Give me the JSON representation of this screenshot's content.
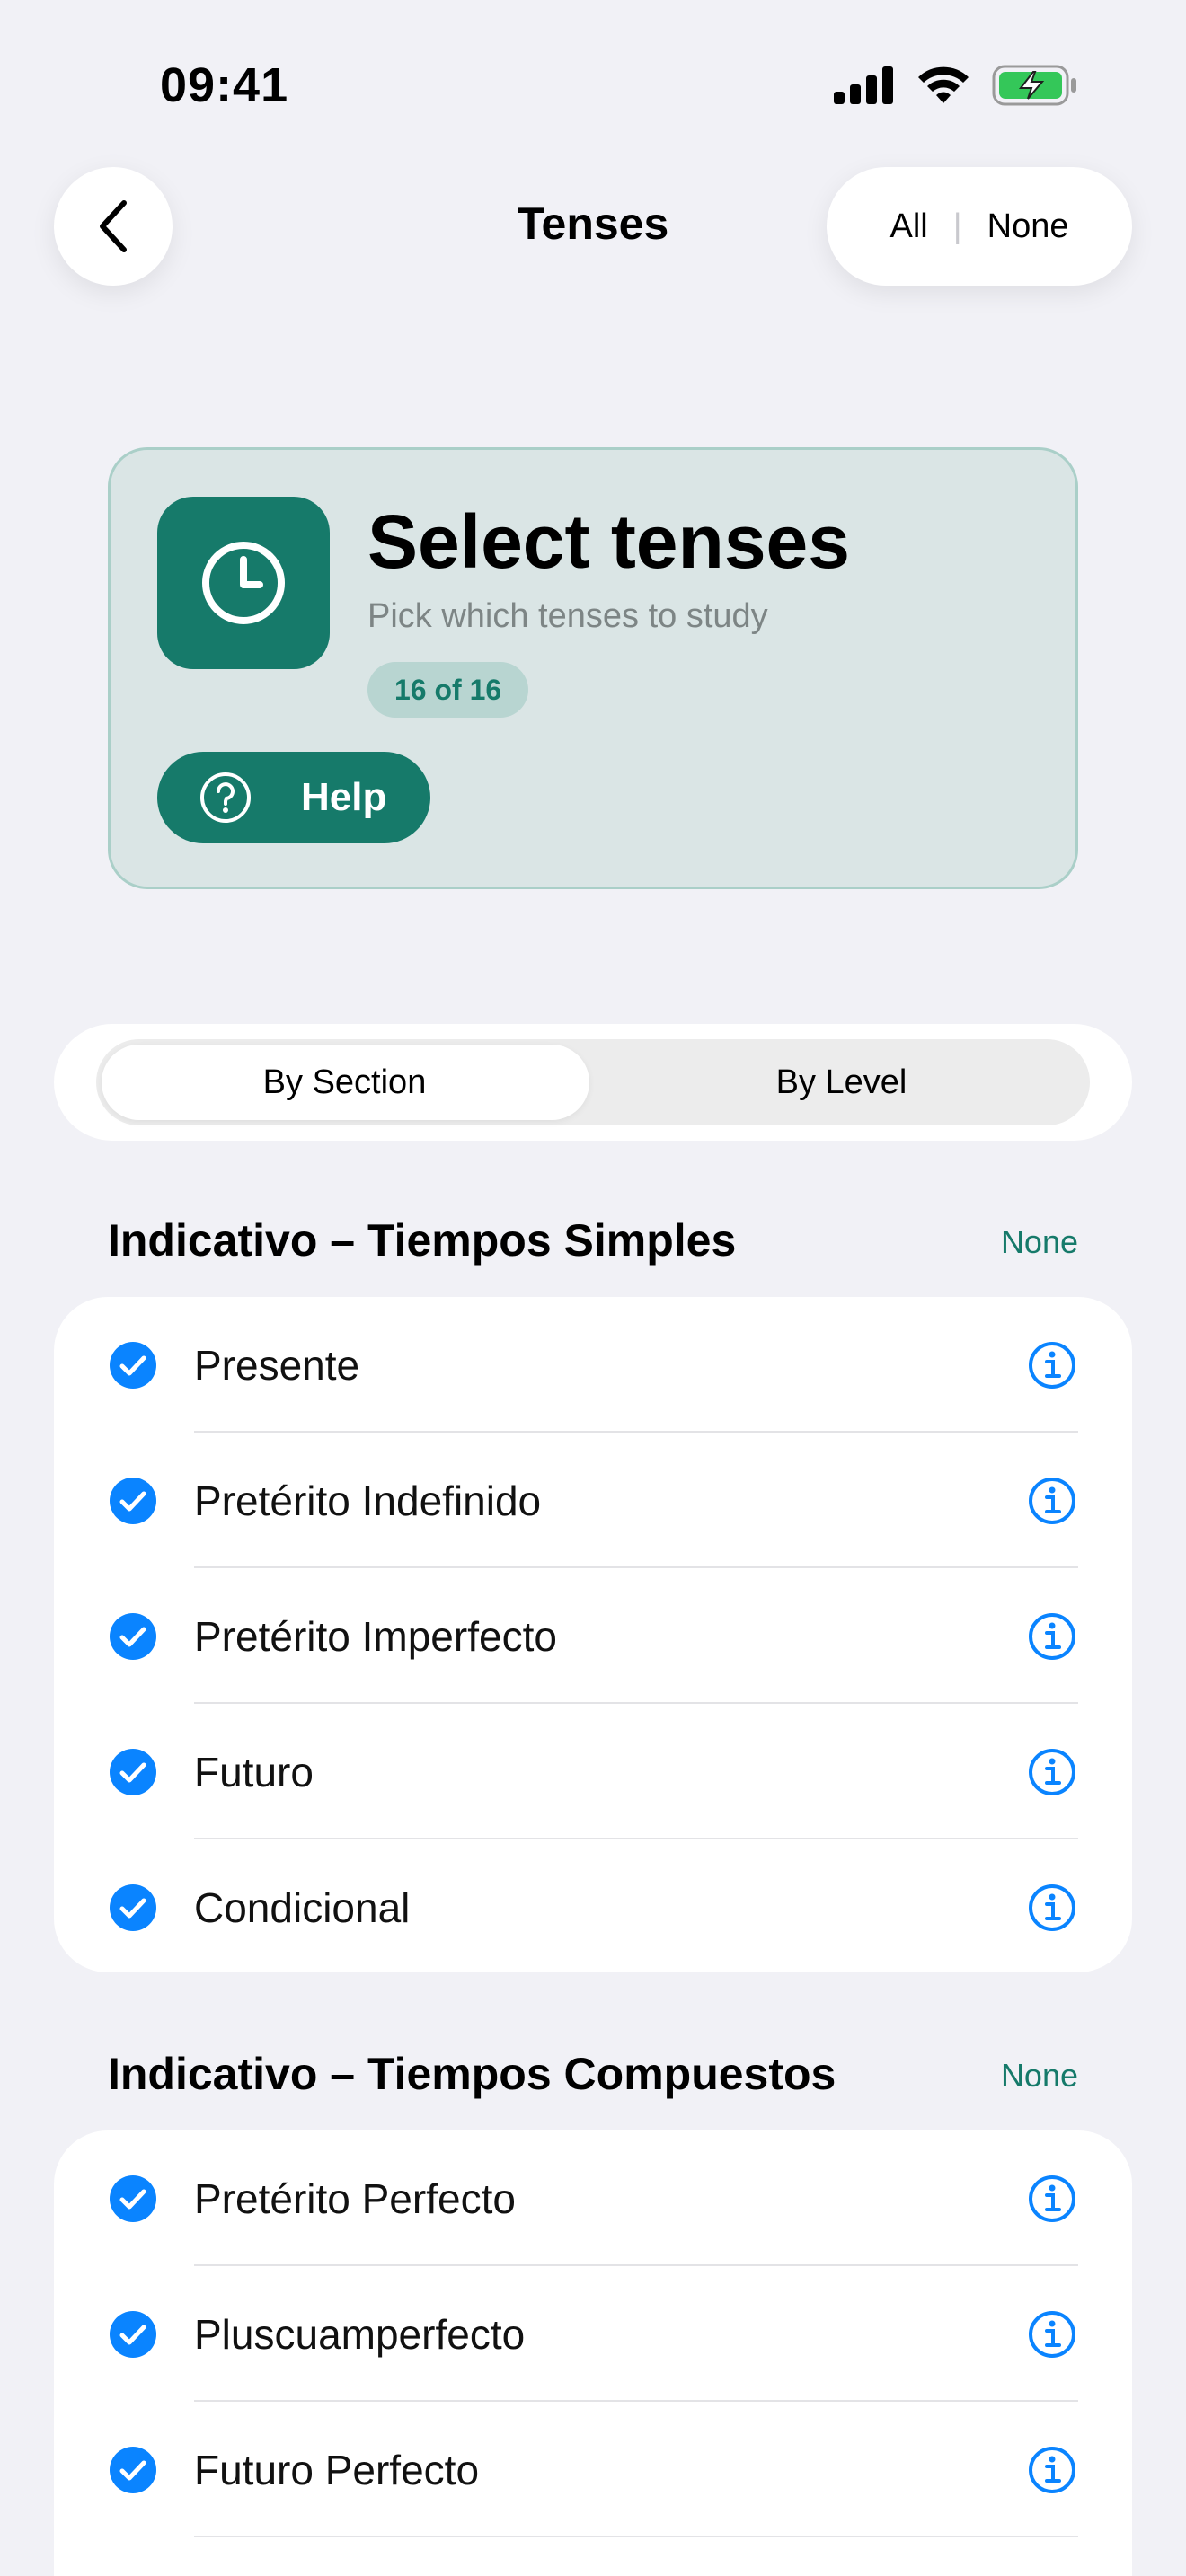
{
  "status_bar": {
    "time": "09:41"
  },
  "nav": {
    "title": "Tenses",
    "all_label": "All",
    "separator": "|",
    "none_label": "None"
  },
  "hero": {
    "title": "Select tenses",
    "subtitle": "Pick which tenses to study",
    "badge": "16 of 16",
    "help_label": "Help"
  },
  "segmented": {
    "options": [
      "By Section",
      "By Level"
    ],
    "selected": "By Section"
  },
  "sections": [
    {
      "title": "Indicativo – Tiempos Simples",
      "action": "None",
      "items": [
        "Presente",
        "Pretérito Indefinido",
        "Pretérito Imperfecto",
        "Futuro",
        "Condicional"
      ]
    },
    {
      "title": "Indicativo – Tiempos Compuestos",
      "action": "None",
      "items": [
        "Pretérito Perfecto",
        "Pluscuamperfecto",
        "Futuro Perfecto"
      ]
    }
  ],
  "colors": {
    "accent": "#167a6a",
    "check": "#0a84ff",
    "background": "#f1f1f6"
  }
}
